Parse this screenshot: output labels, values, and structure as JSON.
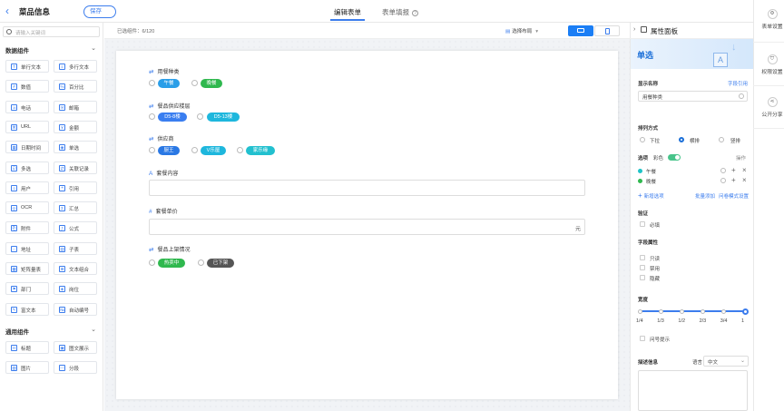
{
  "header": {
    "title": "菜品信息",
    "save": "保存",
    "tab_edit": "编辑表单",
    "tab_fill": "表单填报",
    "help": "?"
  },
  "left": {
    "search_placeholder": "请输入关键词",
    "section1": "数据组件",
    "items1": [
      {
        "label": "单行文本",
        "icon": "T"
      },
      {
        "label": "多行文本",
        "icon": "≡"
      },
      {
        "label": "数值",
        "icon": "#"
      },
      {
        "label": "百分比",
        "icon": "%"
      },
      {
        "label": "电话",
        "icon": "☏"
      },
      {
        "label": "邮箱",
        "icon": "✉"
      },
      {
        "label": "URL",
        "icon": "⌘"
      },
      {
        "label": "金额",
        "icon": "¥"
      },
      {
        "label": "日期时间",
        "icon": "▦"
      },
      {
        "label": "单选",
        "icon": "◉"
      },
      {
        "label": "多选",
        "icon": "☑"
      },
      {
        "label": "关联记录",
        "icon": "⇄"
      },
      {
        "label": "用户",
        "icon": "☺"
      },
      {
        "label": "引用",
        "icon": "❝"
      },
      {
        "label": "OCR",
        "icon": "◎"
      },
      {
        "label": "汇总",
        "icon": "Σ"
      },
      {
        "label": "附件",
        "icon": "⎘"
      },
      {
        "label": "公式",
        "icon": "ƒ"
      },
      {
        "label": "地址",
        "icon": "⌂"
      },
      {
        "label": "子表",
        "icon": "▤"
      },
      {
        "label": "矩阵量表",
        "icon": "▦"
      },
      {
        "label": "文本组合",
        "icon": "⊞"
      },
      {
        "label": "部门",
        "icon": "⚑"
      },
      {
        "label": "岗位",
        "icon": "◈"
      },
      {
        "label": "富文本",
        "icon": "✎"
      },
      {
        "label": "自动编号",
        "icon": "№"
      }
    ],
    "section2": "通用组件",
    "items2": [
      {
        "label": "标题",
        "icon": "H"
      },
      {
        "label": "图文展示",
        "icon": "▣"
      },
      {
        "label": "图片",
        "icon": "▨"
      },
      {
        "label": "分段",
        "icon": "—"
      }
    ]
  },
  "toolbar": {
    "selected": "已选组件：6/120",
    "layout": "选择布局"
  },
  "form": {
    "f1": {
      "label": "用餐种类",
      "options": [
        "午餐",
        "晚餐"
      ]
    },
    "f2": {
      "label": "餐品供应楼层",
      "options": [
        "D5-8楼",
        "D5-13楼"
      ]
    },
    "f3": {
      "label": "供应商",
      "options": [
        "厨王",
        "V乐屋",
        "家乐缘"
      ]
    },
    "f4": {
      "label": "套餐内容"
    },
    "f5": {
      "label": "套餐单价",
      "unit": "元"
    },
    "f6": {
      "label": "餐品上架情况",
      "options": [
        "热卖中",
        "已下架"
      ]
    }
  },
  "colors": {
    "lunch": "#2a9ee8",
    "dinner": "#2fb84e",
    "floor": "#3a7ef0",
    "s1": "#2a78e4",
    "s2": "#1eb7dd",
    "s3": "#22c0cf",
    "hot": "#2fb84e",
    "off": "#555555"
  },
  "right": {
    "title": "属性面板",
    "type": "单选",
    "display_name": "显示名称",
    "field_ref": "字段引用",
    "name_value": "用餐种类",
    "arrange": "排列方式",
    "arr_opts": [
      "下拉",
      "横排",
      "竖排"
    ],
    "options": "选项",
    "color": "彩色",
    "ops": "操作",
    "opts": [
      "午餐",
      "晚餐"
    ],
    "add_option": "新增选项",
    "batch_add": "批量添加",
    "q_setting": "问卷模式设置",
    "validate": "验证",
    "required": "必填",
    "field_attr": "字段属性",
    "readonly": "只读",
    "disabled": "禁用",
    "hidden": "隐藏",
    "width": "宽度",
    "width_value": 1,
    "width_ticks": [
      "1/4",
      "1/3",
      "1/2",
      "2/3",
      "3/4",
      "1"
    ],
    "hint": "问号提示",
    "desc": "描述信息",
    "lang_label": "语言：",
    "lang": "中文"
  },
  "side": {
    "s1": "表单设置",
    "s2": "权限设置",
    "s3": "公开分享"
  }
}
